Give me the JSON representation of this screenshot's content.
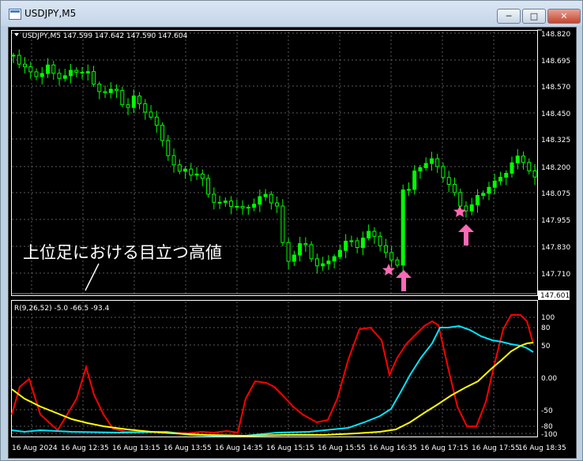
{
  "window": {
    "title": "USDJPY,M5",
    "min_label": "─",
    "max_label": "□",
    "close_label": "✕"
  },
  "main_chart": {
    "header": "USDJPY,M5  147.599 147.642 147.590 147.604",
    "price_labels": [
      "148.820",
      "148.695",
      "148.570",
      "148.450",
      "148.325",
      "148.200",
      "148.075",
      "147.955",
      "147.830",
      "147.710"
    ],
    "current_price": "147.601"
  },
  "annotation": {
    "text": "上位足における目立つ高値"
  },
  "indicator": {
    "header": "R(9,26,52) -5.0 -66.5 -93.4",
    "scale_labels": [
      "100",
      "80",
      "50",
      "0.00",
      "-50",
      "-80",
      "-100"
    ]
  },
  "time_labels": [
    "16 Aug 2024",
    "16 Aug 12:35",
    "16 Aug 13:15",
    "16 Aug 13:55",
    "16 Aug 14:35",
    "16 Aug 15:15",
    "16 Aug 15:55",
    "16 Aug 16:35",
    "16 Aug 17:15",
    "16 Aug 17:55",
    "16 Aug 18:35"
  ],
  "colors": {
    "candle": "#00ff00",
    "line_red": "#ff0000",
    "line_cyan": "#00e5ff",
    "line_yellow": "#ffff00",
    "marker": "#ff69b4"
  },
  "icons": [
    "dropdown-triangle-icon",
    "star-marker-icon",
    "up-arrow-icon"
  ]
}
